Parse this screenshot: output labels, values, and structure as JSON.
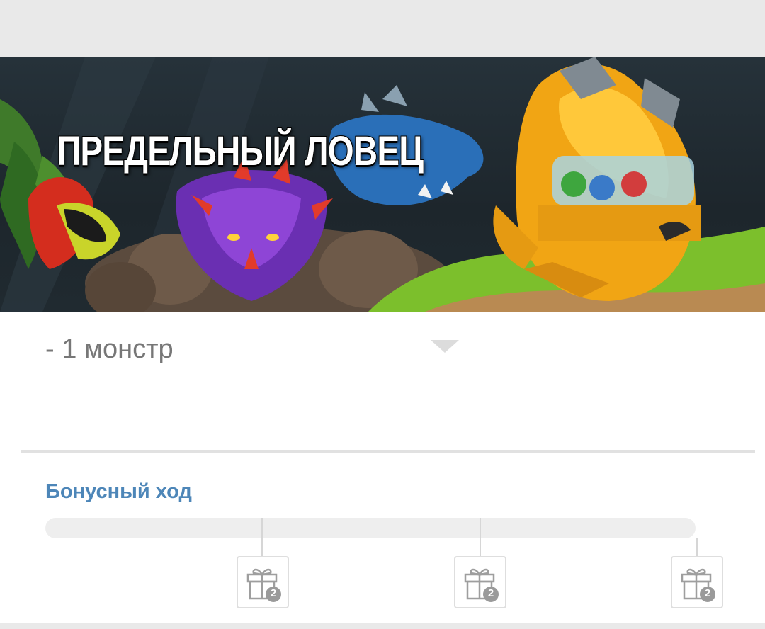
{
  "banner": {
    "title": "ПРЕДЕЛЬНЫЙ ЛОВЕЦ"
  },
  "offer": {
    "item_text": "- 1 монстр"
  },
  "bonus": {
    "title": "Бонусный ход",
    "progress": 0,
    "rewards": [
      {
        "icon": "gift-icon",
        "count": "2"
      },
      {
        "icon": "gift-icon",
        "count": "2"
      },
      {
        "icon": "gift-icon",
        "count": "2"
      }
    ]
  },
  "colors": {
    "accent": "#4d86b8",
    "track": "#eeeeee",
    "text_muted": "#777777"
  }
}
